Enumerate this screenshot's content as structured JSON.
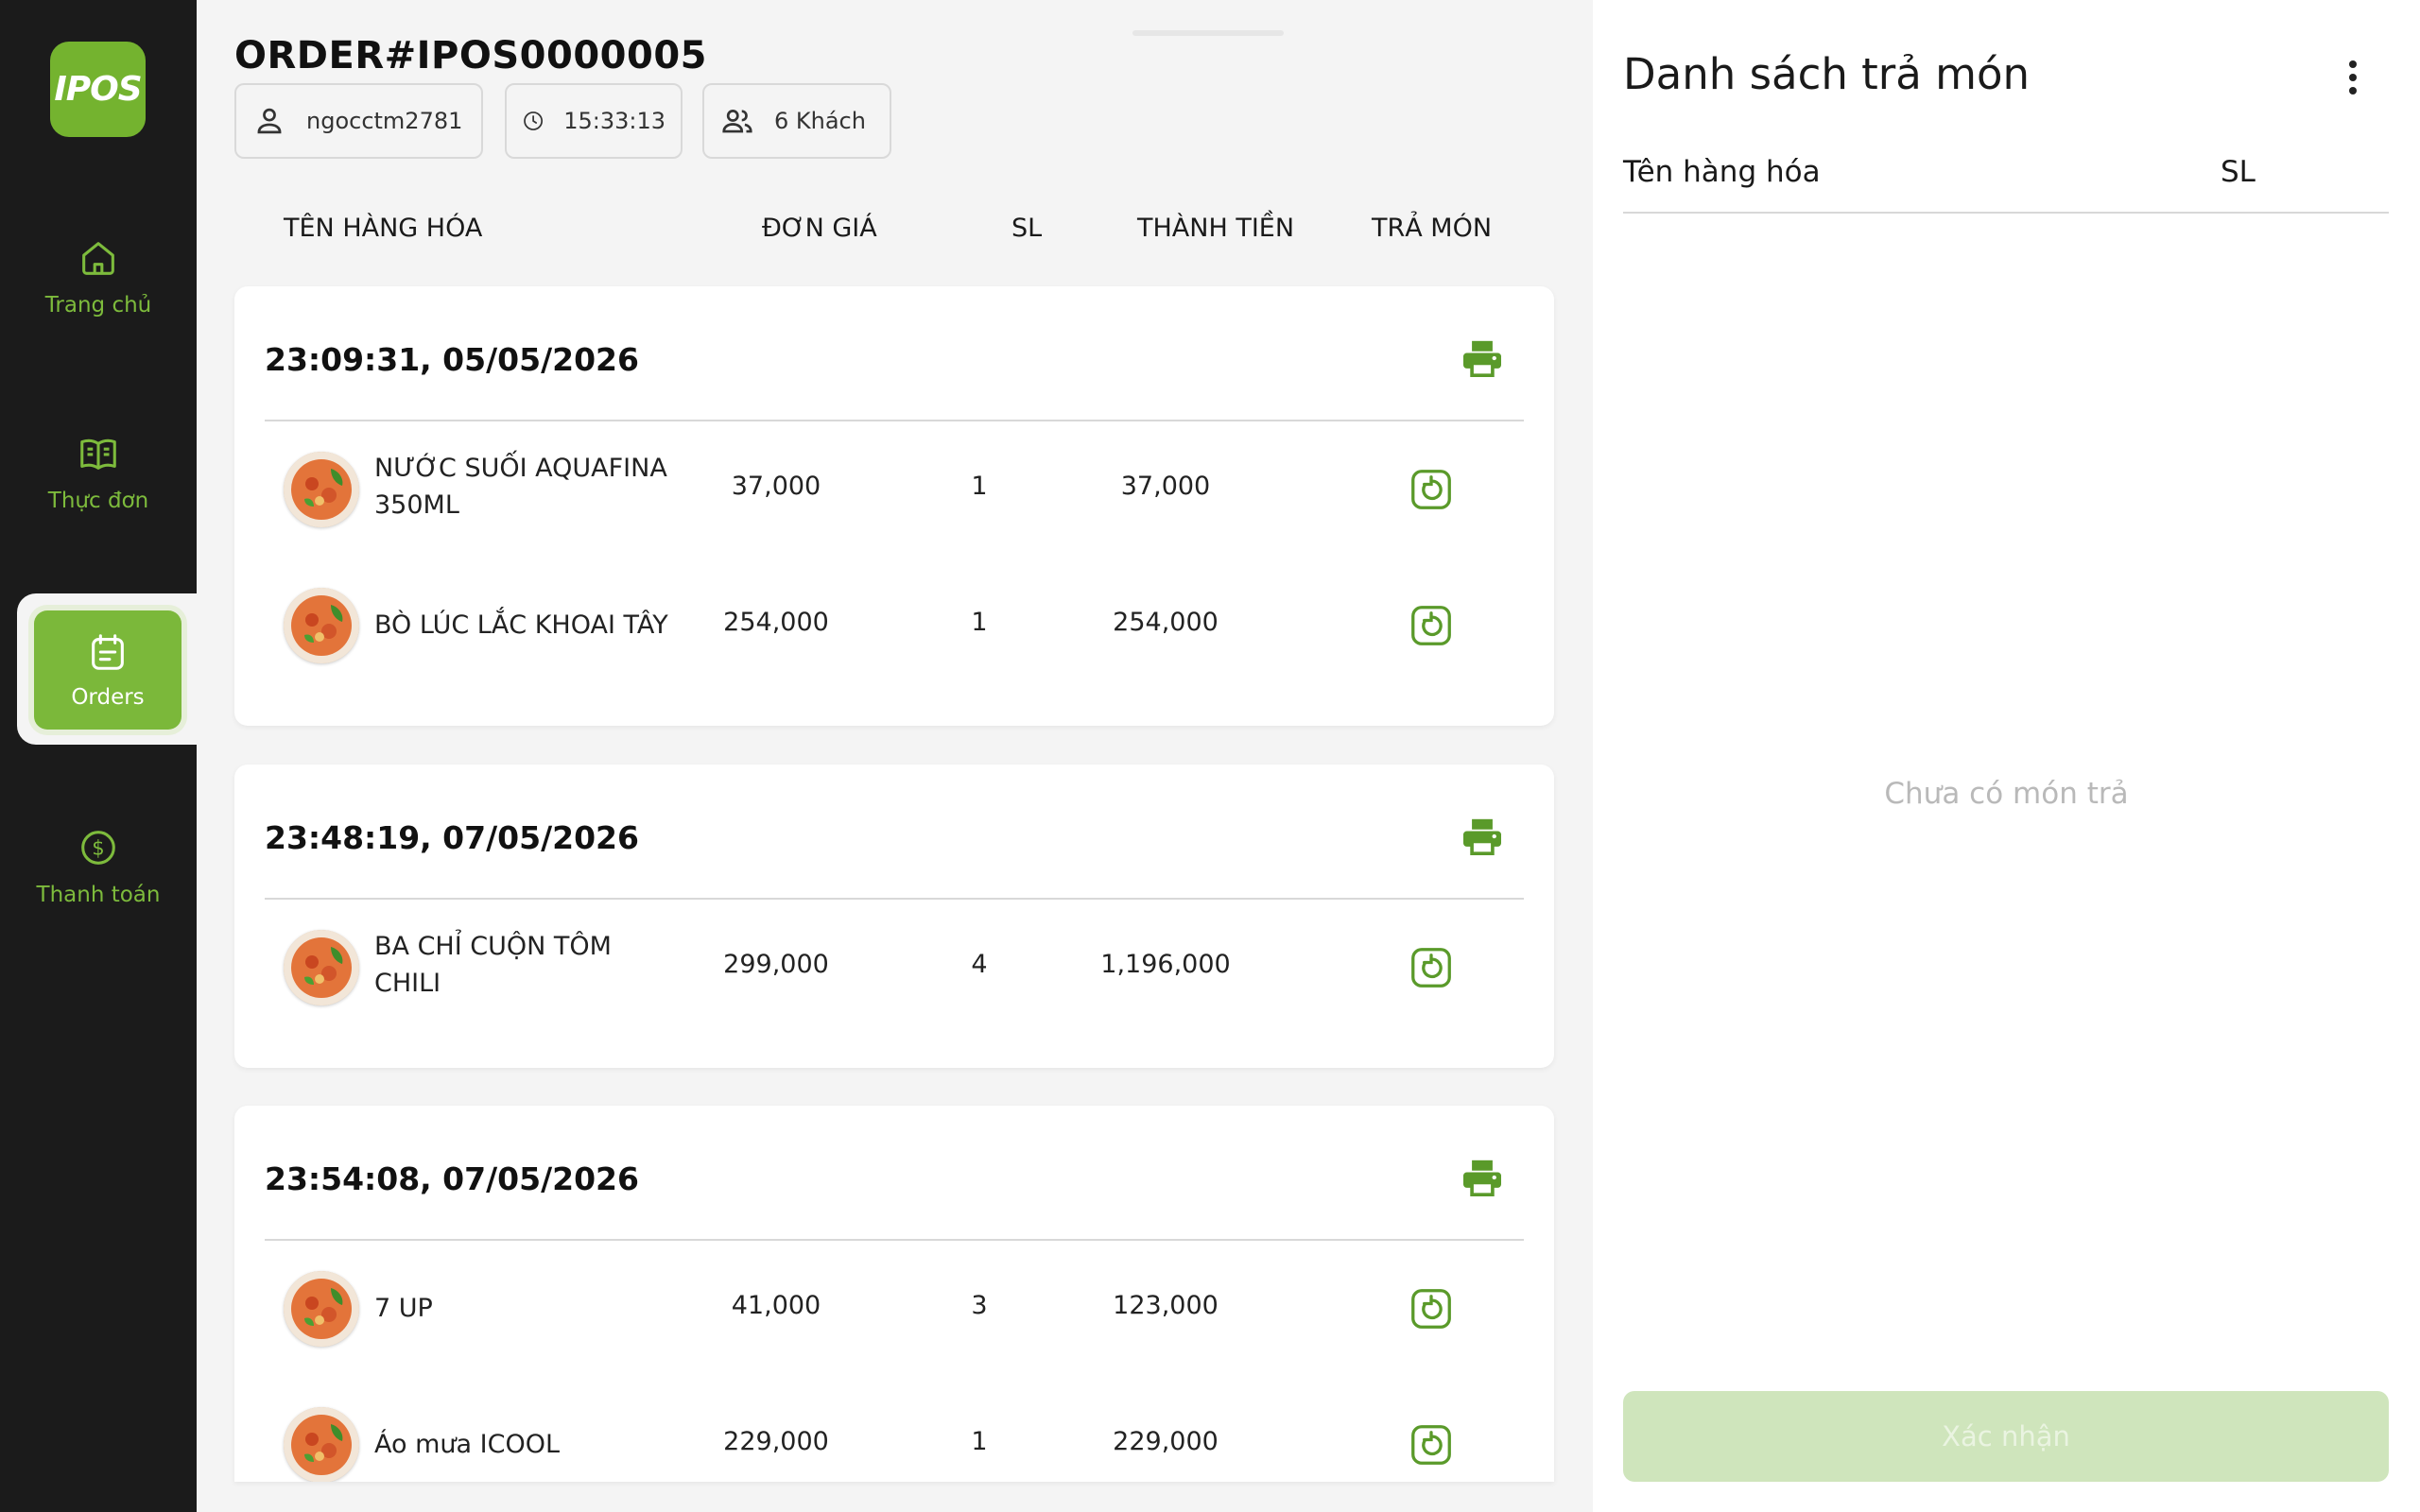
{
  "app": {
    "logo_text": "IPOS",
    "brand_color": "#7bb83a"
  },
  "sidebar": {
    "items": [
      {
        "label": "Trang chủ",
        "icon": "home-icon"
      },
      {
        "label": "Thực đơn",
        "icon": "book-icon"
      },
      {
        "label": "Orders",
        "icon": "orders-icon",
        "active": true
      },
      {
        "label": "Thanh toán",
        "icon": "dollar-icon"
      }
    ]
  },
  "order": {
    "title": "ORDER#IPOS0000005",
    "user": "ngocctm2781",
    "time": "15:33:13",
    "guests": "6 Khách"
  },
  "columns": {
    "name": "TÊN HÀNG HÓA",
    "price": "ĐƠN GIÁ",
    "qty": "SL",
    "total": "THÀNH TIỀN",
    "return": "TRẢ MÓN"
  },
  "groups": [
    {
      "timestamp": "23:09:31, 05/05/2026",
      "items": [
        {
          "name": "NƯỚC SUỐI AQUAFINA 350ML",
          "price": "37,000",
          "qty": "1",
          "total": "37,000"
        },
        {
          "name": "BÒ LÚC LẮC KHOAI TÂY",
          "price": "254,000",
          "qty": "1",
          "total": "254,000"
        }
      ]
    },
    {
      "timestamp": "23:48:19, 07/05/2026",
      "items": [
        {
          "name": "BA CHỈ CUỘN TÔM CHILI",
          "price": "299,000",
          "qty": "4",
          "total": "1,196,000"
        }
      ]
    },
    {
      "timestamp": "23:54:08, 07/05/2026",
      "items": [
        {
          "name": "7 UP",
          "price": "41,000",
          "qty": "3",
          "total": "123,000"
        },
        {
          "name": "Áo mưa ICOOL",
          "price": "229,000",
          "qty": "1",
          "total": "229,000"
        }
      ]
    }
  ],
  "panel": {
    "title": "Danh sách trả món",
    "col_name": "Tên hàng hóa",
    "col_qty": "SL",
    "empty": "Chưa có món trả",
    "confirm": "Xác nhận"
  }
}
